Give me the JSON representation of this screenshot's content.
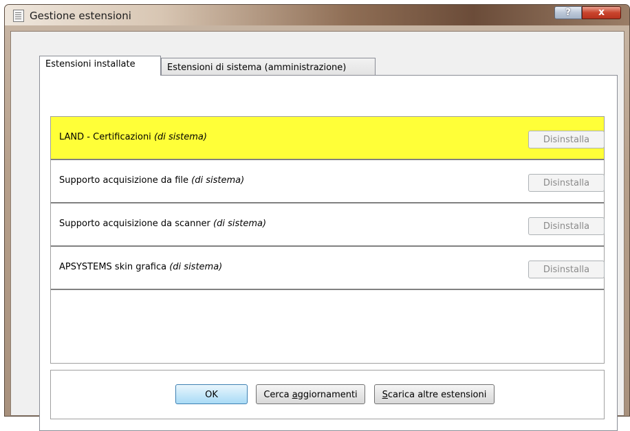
{
  "window": {
    "title": "Gestione estensioni",
    "help_label": "?",
    "close_label": "x"
  },
  "tabs": [
    {
      "label": "Estensioni installate",
      "active": true
    },
    {
      "label": "Estensioni di sistema (amministrazione)",
      "active": false
    }
  ],
  "extensions": [
    {
      "name": "LAND - Certificazioni",
      "tag": "(di sistema)",
      "button": "Disinstalla",
      "selected": true
    },
    {
      "name": "Supporto acquisizione da file",
      "tag": "(di sistema)",
      "button": "Disinstalla",
      "selected": false
    },
    {
      "name": "Supporto acquisizione da scanner",
      "tag": "(di sistema)",
      "button": "Disinstalla",
      "selected": false
    },
    {
      "name": "APSYSTEMS skin grafica",
      "tag": "(di sistema)",
      "button": "Disinstalla",
      "selected": false
    }
  ],
  "buttons": {
    "ok": "OK",
    "updates_pre": "Cerca ",
    "updates_accel": "a",
    "updates_post": "ggiornamenti",
    "more_accel": "S",
    "more_post": "carica altre estensioni"
  },
  "colors": {
    "selected_row": "#ffff38",
    "ok_border": "#3c7fb1",
    "close_button": "#c9442d"
  }
}
